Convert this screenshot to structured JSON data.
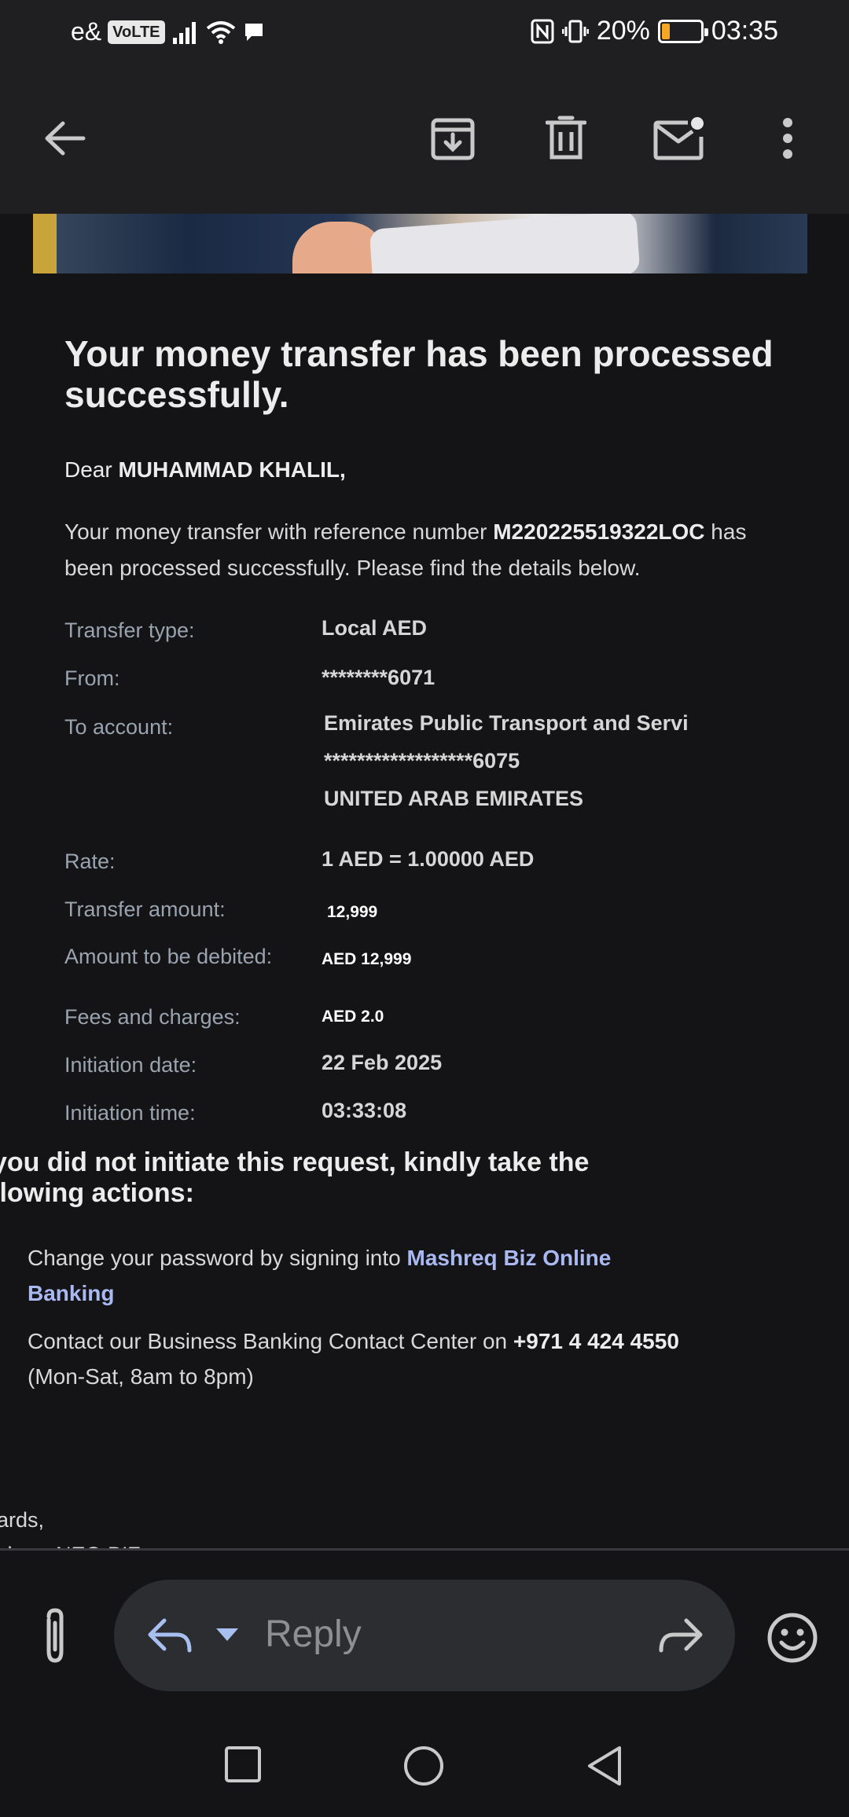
{
  "status_bar": {
    "carrier": "e&",
    "volte": "VoLTE",
    "battery_pct": "20%",
    "battery_level": 0.2,
    "time": "03:35"
  },
  "toolbar": {
    "icons": [
      "back-arrow-icon",
      "archive-icon",
      "delete-icon",
      "mark-unread-icon",
      "more-vert-icon"
    ]
  },
  "email": {
    "heading": "Your money transfer has been processed successfully.",
    "greeting_prefix": "Dear ",
    "greeting_name": "MUHAMMAD KHALIL,",
    "intro_prefix": "Your money transfer with reference number ",
    "reference": "M220225519322LOC",
    "intro_suffix": " has been processed successfully. Please find the details below."
  },
  "details": {
    "transfer_type_label": "Transfer type:",
    "transfer_type": "Local AED",
    "from_label": "From:",
    "from": "********6071",
    "to_account_label": "To account:",
    "to_account_name": "Emirates Public Transport and Servi",
    "to_account_number": "******************6075",
    "to_account_country": "UNITED ARAB EMIRATES",
    "rate_label": "Rate:",
    "rate": "1 AED = 1.00000 AED",
    "transfer_amount_label": "Transfer amount:",
    "transfer_amount": "12,999",
    "amount_debited_label": "Amount to be debited:",
    "amount_debited": "AED 12,999",
    "fees_label": "Fees and charges:",
    "fees": "AED 2.0",
    "initiation_date_label": "Initiation date:",
    "initiation_date": "22 Feb 2025",
    "initiation_time_label": "Initiation time:",
    "initiation_time": "03:33:08"
  },
  "warning": {
    "heading_line1": "you did not initiate this request, kindly take the",
    "heading_line2": "llowing actions:",
    "action1_prefix": "Change your password by signing into ",
    "action1_link": "Mashreq Biz Online Banking",
    "action2_prefix": "Contact our Business Banking Contact Center on ",
    "action2_phone": "+971 4 424 4550",
    "action2_suffix": " (Mon-Sat, 8am to 8pm)"
  },
  "closing": {
    "regards": "ards,",
    "signoff": "shreq NEO BIZ"
  },
  "reply_bar": {
    "reply_label": "Reply"
  },
  "colors": {
    "background": "#141416",
    "toolbar": "#1f1f21",
    "link": "#aab9f2",
    "label": "#9aa3b0",
    "battery": "#f5a623"
  }
}
